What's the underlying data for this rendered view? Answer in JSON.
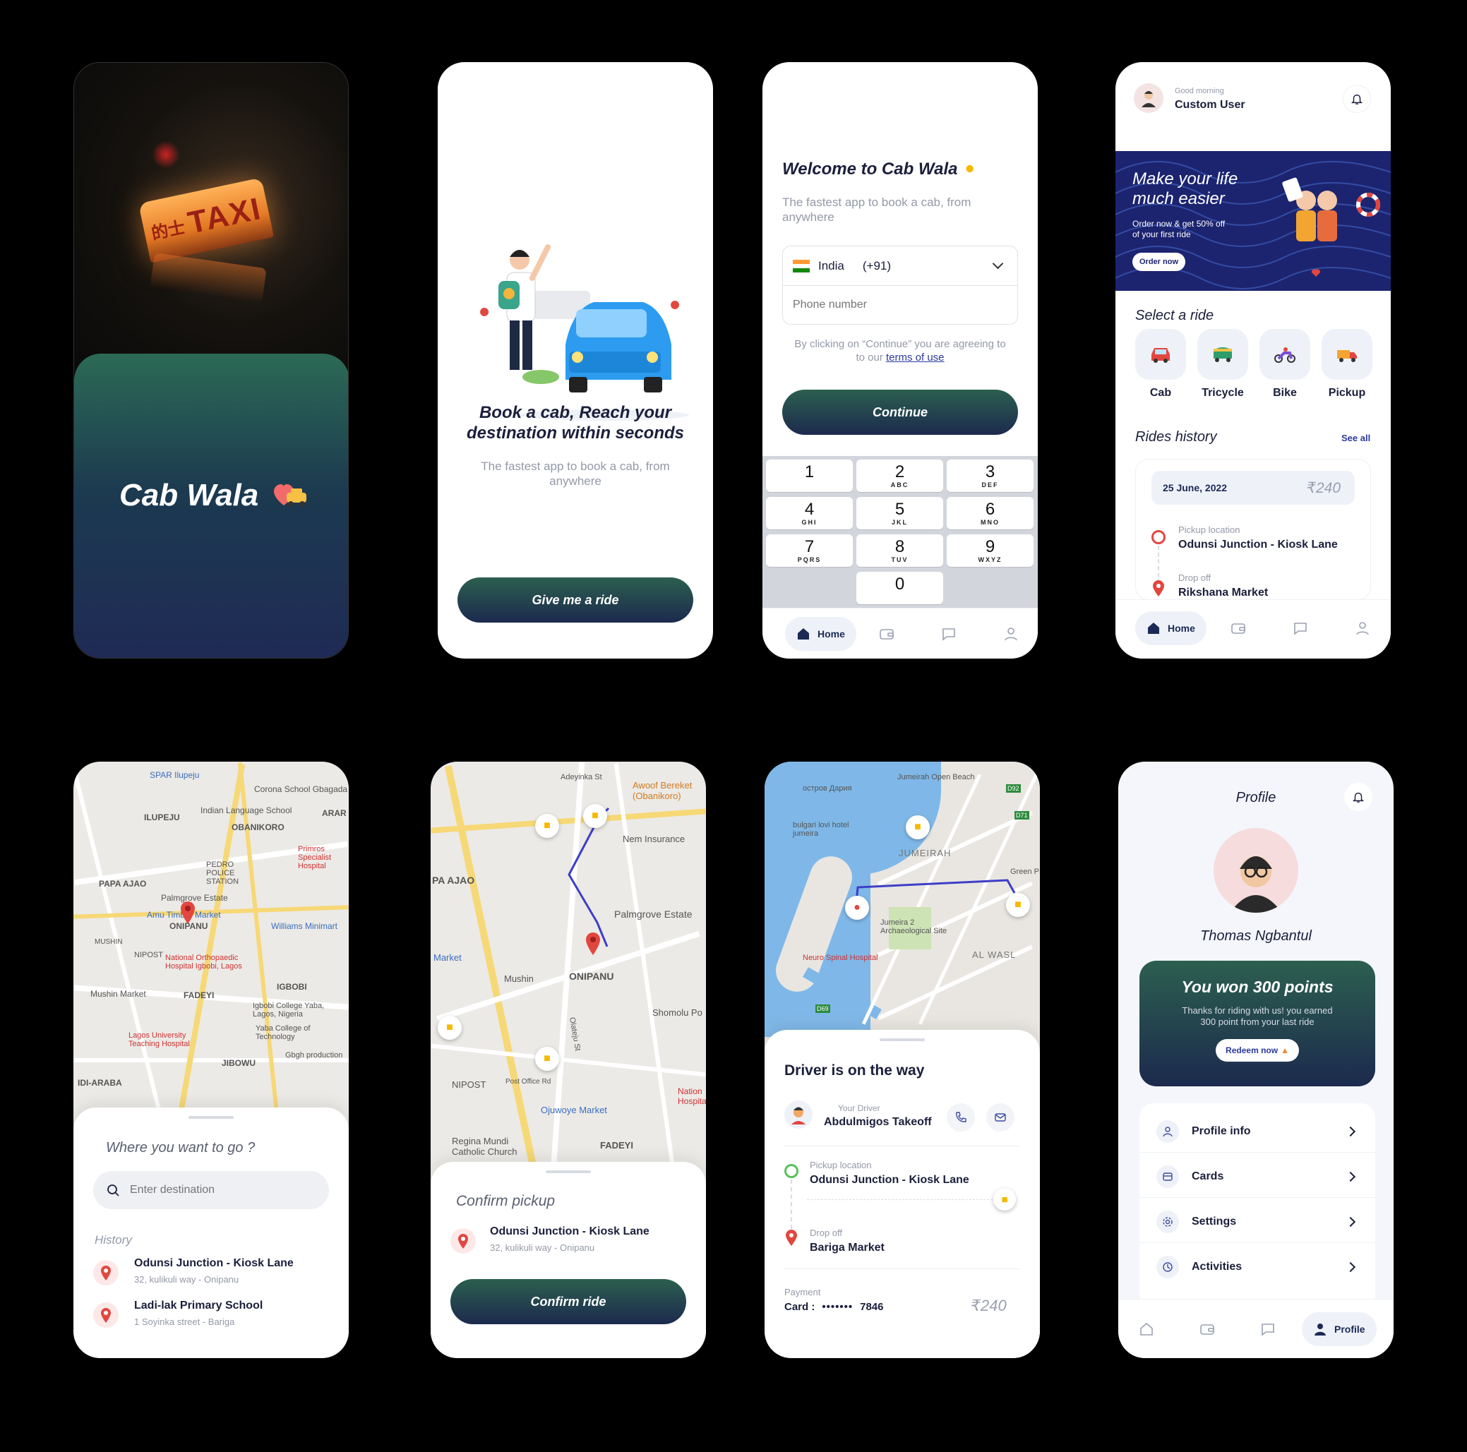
{
  "splash": {
    "title": "Cab Wala",
    "taxi_sign": "TAXI",
    "taxi_sign_chars": "的士"
  },
  "onboarding": {
    "heading_line1": "Book a cab, Reach your",
    "heading_line2": "destination within seconds",
    "subtitle_line1": "The fastest app to book a cab, from",
    "subtitle_line2": "anywhere",
    "button": "Give me a ride"
  },
  "login": {
    "title": "Welcome to Cab Wala",
    "subtitle_line1": "The fastest app to book a cab, from",
    "subtitle_line2": "anywhere",
    "country": "India",
    "code": "(+91)",
    "phone_placeholder": "Phone number",
    "terms_line1": "By clicking on “Continue” you are agreeing to",
    "terms_line2_prefix": "to our ",
    "terms_link": "terms of use",
    "button": "Continue",
    "keys": [
      {
        "n": "1",
        "l": ""
      },
      {
        "n": "2",
        "l": "ABC"
      },
      {
        "n": "3",
        "l": "DEF"
      },
      {
        "n": "4",
        "l": "GHI"
      },
      {
        "n": "5",
        "l": "JKL"
      },
      {
        "n": "6",
        "l": "MNO"
      },
      {
        "n": "7",
        "l": "PQRS"
      },
      {
        "n": "8",
        "l": "TUV"
      },
      {
        "n": "9",
        "l": "WXYZ"
      },
      {
        "n": "0",
        "l": ""
      }
    ],
    "nav_home": "Home"
  },
  "home": {
    "greeting": "Good morning",
    "user": "Custom User",
    "banner_title_line1": "Make your life",
    "banner_title_line2": "much easier",
    "banner_sub_line1": "Order now & get 50% off",
    "banner_sub_line2": "of your first ride",
    "banner_btn": "Order now",
    "select_ride": "Select a ride",
    "rides": [
      "Cab",
      "Tricycle",
      "Bike",
      "Pickup"
    ],
    "history_title": "Rides history",
    "see_all": "See all",
    "history_date": "25 June, 2022",
    "history_price": "₹240",
    "pickup_label": "Pickup location",
    "pickup_value": "Odunsi Junction - Kiosk Lane",
    "drop_label": "Drop off",
    "drop_value": "Rikshana Market",
    "nav_home": "Home"
  },
  "search": {
    "map_labels": [
      "SPAR Ilupeju",
      "Corona School Gbagada",
      "ILUPEJU",
      "Indian Language School",
      "OBANIKORO",
      "PEDRO POLICE STATION",
      "PAPA AJAO",
      "Palmgrove Estate",
      "Amu Timber Market",
      "ONIPANU",
      "Williams Minimart",
      "MUSHIN",
      "NIPOST",
      "National Orthopaedic Hospital Igbobi, Lagos",
      "Mushin Market",
      "FADEYI",
      "IGBOBI",
      "Igbobi College Yaba, Lagos, Nigeria",
      "Yaba College of Technology",
      "Lagos University Teaching Hospital",
      "JIBOWU",
      "Gbgh production",
      "IDI-ARABA",
      "Primros Specialist Hospital",
      "ARAR"
    ],
    "prompt": "Where you want to go ?",
    "placeholder": "Enter destination",
    "history_label": "History",
    "items": [
      {
        "title": "Odunsi Junction - Kiosk Lane",
        "sub": "32, kulikuli way - Onipanu"
      },
      {
        "title": "Ladi-lak Primary School",
        "sub": "1 Soyinka street - Bariga"
      }
    ]
  },
  "confirm": {
    "map_labels": [
      "Adeyinka St",
      "Awoof Bereket (Obanikoro)",
      "Nem Insurance",
      "PA AJAO",
      "Palmgrove Estate",
      "Market",
      "Mushin",
      "ONIPANU",
      "Shomolu Po",
      "NIPOST",
      "Ojuwoye Market",
      "Regina Mundi Catholic Church",
      "FADEYI",
      "Nation Hospita",
      "Post Office Rd",
      "Olateju St"
    ],
    "title": "Confirm pickup",
    "place": "Odunsi Junction - Kiosk Lane",
    "address": "32, kulikuli way - Onipanu",
    "button": "Confirm ride"
  },
  "driver": {
    "map_labels": [
      "Jumeirah Open Beach",
      "остров Дария",
      "bulgari lovi hotel jumeira",
      "JUMEIRAH",
      "Jumeira 2 Archaeological Site",
      "Neuro Spinal Hospital",
      "AL WASL",
      "Green P",
      "D92",
      "D71",
      "D69"
    ],
    "title": "Driver is on the way",
    "driver_label": "Your Driver",
    "driver_name": "Abdulmigos Takeoff",
    "pickup_label": "Pickup location",
    "pickup_value": "Odunsi Junction - Kiosk Lane",
    "drop_label": "Drop off",
    "drop_value": "Bariga Market",
    "payment_label": "Payment",
    "card_prefix": "Card :",
    "card_dots": "•••••••",
    "card_last4": "7846",
    "price": "₹240"
  },
  "profile": {
    "title": "Profile",
    "name": "Thomas Ngbantul",
    "points_title": "You won 300 points",
    "points_sub_line1": "Thanks for riding with us! you earned",
    "points_sub_line2": "300 point from your last ride",
    "redeem": "Redeem now",
    "menu": [
      "Profile info",
      "Cards",
      "Settings",
      "Activities"
    ],
    "nav_profile": "Profile"
  },
  "colors": {
    "primary_dark": "#1c2a4e",
    "primary_green": "#2c5f4f",
    "accent_red": "#e2473f",
    "link": "#2b3a9b"
  }
}
